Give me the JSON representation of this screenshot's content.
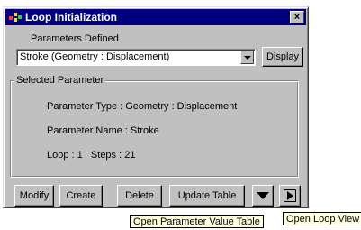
{
  "window": {
    "title": "Loop Initialization",
    "close_glyph": "×"
  },
  "parameters_defined_label": "Parameters Defined",
  "parameter_select": {
    "value": "Stroke (Geometry : Displacement)"
  },
  "display_button": "Display",
  "selected_parameter": {
    "legend": "Selected Parameter",
    "type_line": "Parameter Type : Geometry : Displacement",
    "name_line": "Parameter Name : Stroke",
    "loop_line": "Loop : 1   Steps : 21"
  },
  "buttons": {
    "modify": "Modify",
    "create": "Create",
    "delete": "Delete",
    "update_table": "Update Table"
  },
  "tooltips": {
    "parameter_value_table": "Open Parameter Value Table",
    "loop_view": "Open Loop View"
  },
  "icons": {
    "app": "loop-app-icon",
    "close": "close-icon",
    "combo_arrow": "chevron-down-icon",
    "value_table": "down-triangle-icon",
    "loop_view": "play-icon"
  }
}
